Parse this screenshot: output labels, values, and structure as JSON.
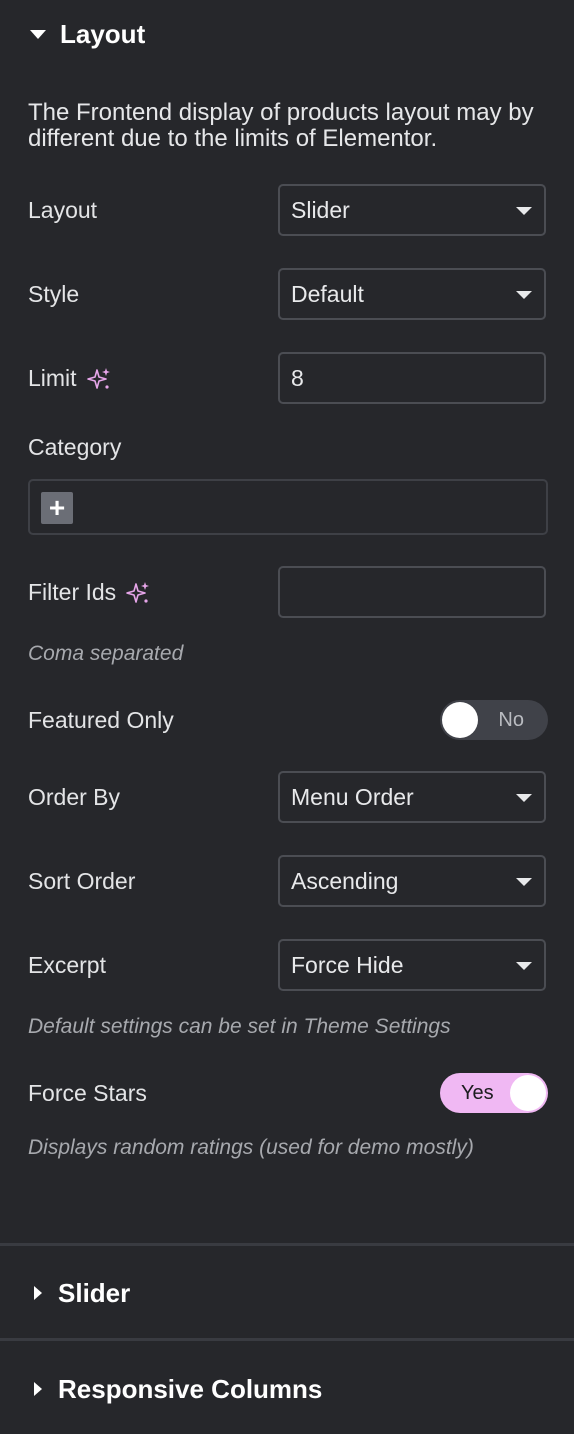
{
  "sections": {
    "layout_title": "Layout",
    "slider_title": "Slider",
    "responsive_title": "Responsive Columns"
  },
  "notice": "The Frontend display of products layout may by different due to the limits of Elementor.",
  "fields": {
    "layout": {
      "label": "Layout",
      "value": "Slider"
    },
    "style": {
      "label": "Style",
      "value": "Default"
    },
    "limit": {
      "label": "Limit",
      "value": "8"
    },
    "category": {
      "label": "Category",
      "add": "+"
    },
    "filter_ids": {
      "label": "Filter Ids",
      "value": "",
      "hint": "Coma separated"
    },
    "featured_only": {
      "label": "Featured Only",
      "state": "No"
    },
    "order_by": {
      "label": "Order By",
      "value": "Menu Order"
    },
    "sort_order": {
      "label": "Sort Order",
      "value": "Ascending"
    },
    "excerpt": {
      "label": "Excerpt",
      "value": "Force Hide",
      "hint": "Default settings can be set in Theme Settings"
    },
    "force_stars": {
      "label": "Force Stars",
      "state": "Yes",
      "hint": "Displays random ratings (used for demo mostly)"
    }
  },
  "colors": {
    "background": "#26272b",
    "accent": "#f0b8f3",
    "sparkle": "#e7a6ea",
    "border": "#4b4d53"
  },
  "icons": {
    "ai_sparkle": "sparkle-icon",
    "dropdown": "caret-down-icon",
    "add": "plus-icon"
  }
}
